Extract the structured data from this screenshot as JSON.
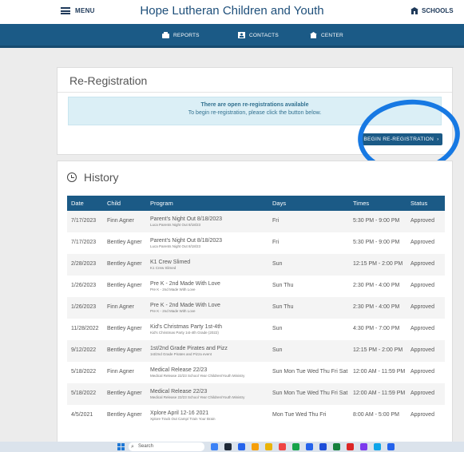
{
  "header": {
    "menu_label": "MENU",
    "title": "Hope Lutheran Children and Youth",
    "schools_label": "SCHOOLS"
  },
  "nav": {
    "reports": "REPORTS",
    "contacts": "CONTACTS",
    "center": "CENTER"
  },
  "rereg": {
    "title": "Re-Registration",
    "info_title": "There are open re-registrations available",
    "info_text": "To begin re-registration, please click the button below.",
    "button_label": "BEGIN RE-REGISTRATION",
    "button_icon": "chevron-right-icon"
  },
  "history": {
    "title": "History",
    "columns": [
      "Date",
      "Child",
      "Program",
      "Days",
      "Times",
      "Status"
    ],
    "rows": [
      {
        "date": "7/17/2023",
        "child": "Finn Agner",
        "program": "Parent's Night Out 8/18/2023",
        "sub": "Luca Parents Night Out 8/18/23",
        "days": "Fri",
        "times": "5:30 PM - 9:00 PM",
        "status": "Approved"
      },
      {
        "date": "7/17/2023",
        "child": "Bentley Agner",
        "program": "Parent's Night Out 8/18/2023",
        "sub": "Luca Parents Night Out 8/18/23",
        "days": "Fri",
        "times": "5:30 PM - 9:00 PM",
        "status": "Approved"
      },
      {
        "date": "2/28/2023",
        "child": "Bentley Agner",
        "program": "K1 Crew Slimed",
        "sub": "K1 Crew Slimed",
        "days": "Sun",
        "times": "12:15 PM - 2:00 PM",
        "status": "Approved"
      },
      {
        "date": "1/26/2023",
        "child": "Bentley Agner",
        "program": "Pre K - 2nd Made With Love",
        "sub": "Pre K - 2nd Made With Love",
        "days": "Sun Thu",
        "times": "2:30 PM - 4:00 PM",
        "status": "Approved"
      },
      {
        "date": "1/26/2023",
        "child": "Finn Agner",
        "program": "Pre K - 2nd Made With Love",
        "sub": "Pre K - 2nd Made With Love",
        "days": "Sun Thu",
        "times": "2:30 PM - 4:00 PM",
        "status": "Approved"
      },
      {
        "date": "11/28/2022",
        "child": "Bentley Agner",
        "program": "Kid's Christmas Party 1st-4th",
        "sub": "Kid's Christmas Party 1st-4th Grade (2022)",
        "days": "Sun",
        "times": "4:30 PM - 7:00 PM",
        "status": "Approved"
      },
      {
        "date": "9/12/2022",
        "child": "Bentley Agner",
        "program": "1st/2nd Grade Pirates and Pizz",
        "sub": "1st/2nd Grade Pirates and Pizza event",
        "days": "Sun",
        "times": "12:15 PM - 2:00 PM",
        "status": "Approved"
      },
      {
        "date": "5/18/2022",
        "child": "Finn Agner",
        "program": "Medical Release 22/23",
        "sub": "Medical Release 22/23 School Year Children/Youth Ministry",
        "days": "Sun Mon Tue Wed Thu Fri Sat",
        "times": "12:00 AM - 11:59 PM",
        "status": "Approved"
      },
      {
        "date": "5/18/2022",
        "child": "Bentley Agner",
        "program": "Medical Release 22/23",
        "sub": "Medical Release 22/23 School Year Children/Youth Ministry",
        "days": "Sun Mon Tue Wed Thu Fri Sat",
        "times": "12:00 AM - 11:59 PM",
        "status": "Approved"
      },
      {
        "date": "4/5/2021",
        "child": "Bentley Agner",
        "program": "Xplore April 12-16 2021",
        "sub": "Xplore Track Out Camp/ Train Your Brain",
        "days": "Mon Tue Wed Thu Fri",
        "times": "8:00 AM - 5:00 PM",
        "status": "Approved"
      }
    ]
  },
  "taskbar": {
    "search_label": "Search",
    "icon_colors": [
      "#3b82f6",
      "#1f2937",
      "#2563eb",
      "#f59e0b",
      "#eab308",
      "#ef4444",
      "#16a34a",
      "#2563eb",
      "#1d4ed8",
      "#15803d",
      "#dc2626",
      "#7c3aed",
      "#0ea5e9",
      "#2563eb"
    ]
  },
  "colors": {
    "brand_blue": "#1b5a86",
    "info_bg": "#dbeff6",
    "annotation_blue": "#1779e3"
  }
}
